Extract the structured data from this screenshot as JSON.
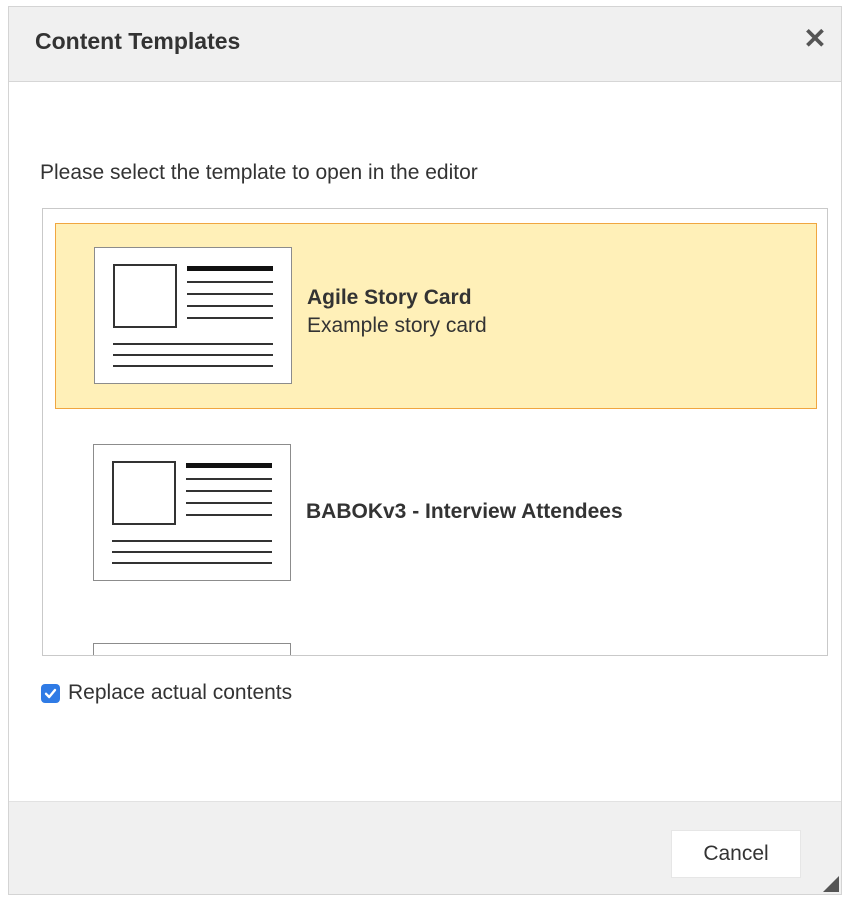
{
  "dialog": {
    "title": "Content Templates",
    "close_icon": "close-icon",
    "prompt": "Please select the template to open in the editor",
    "templates": [
      {
        "title": "Agile Story Card",
        "description": "Example story card",
        "selected": true,
        "icon": "template-thumbnail-icon"
      },
      {
        "title": "BABOKv3 - Interview Attendees",
        "description": "",
        "selected": false,
        "icon": "template-thumbnail-icon"
      }
    ],
    "replace_checkbox": {
      "label": "Replace actual contents",
      "checked": true
    },
    "cancel_label": "Cancel",
    "colors": {
      "selected_bg": "#fff0b8",
      "selected_border": "#f0a640",
      "checkbox": "#2f7be5"
    }
  }
}
